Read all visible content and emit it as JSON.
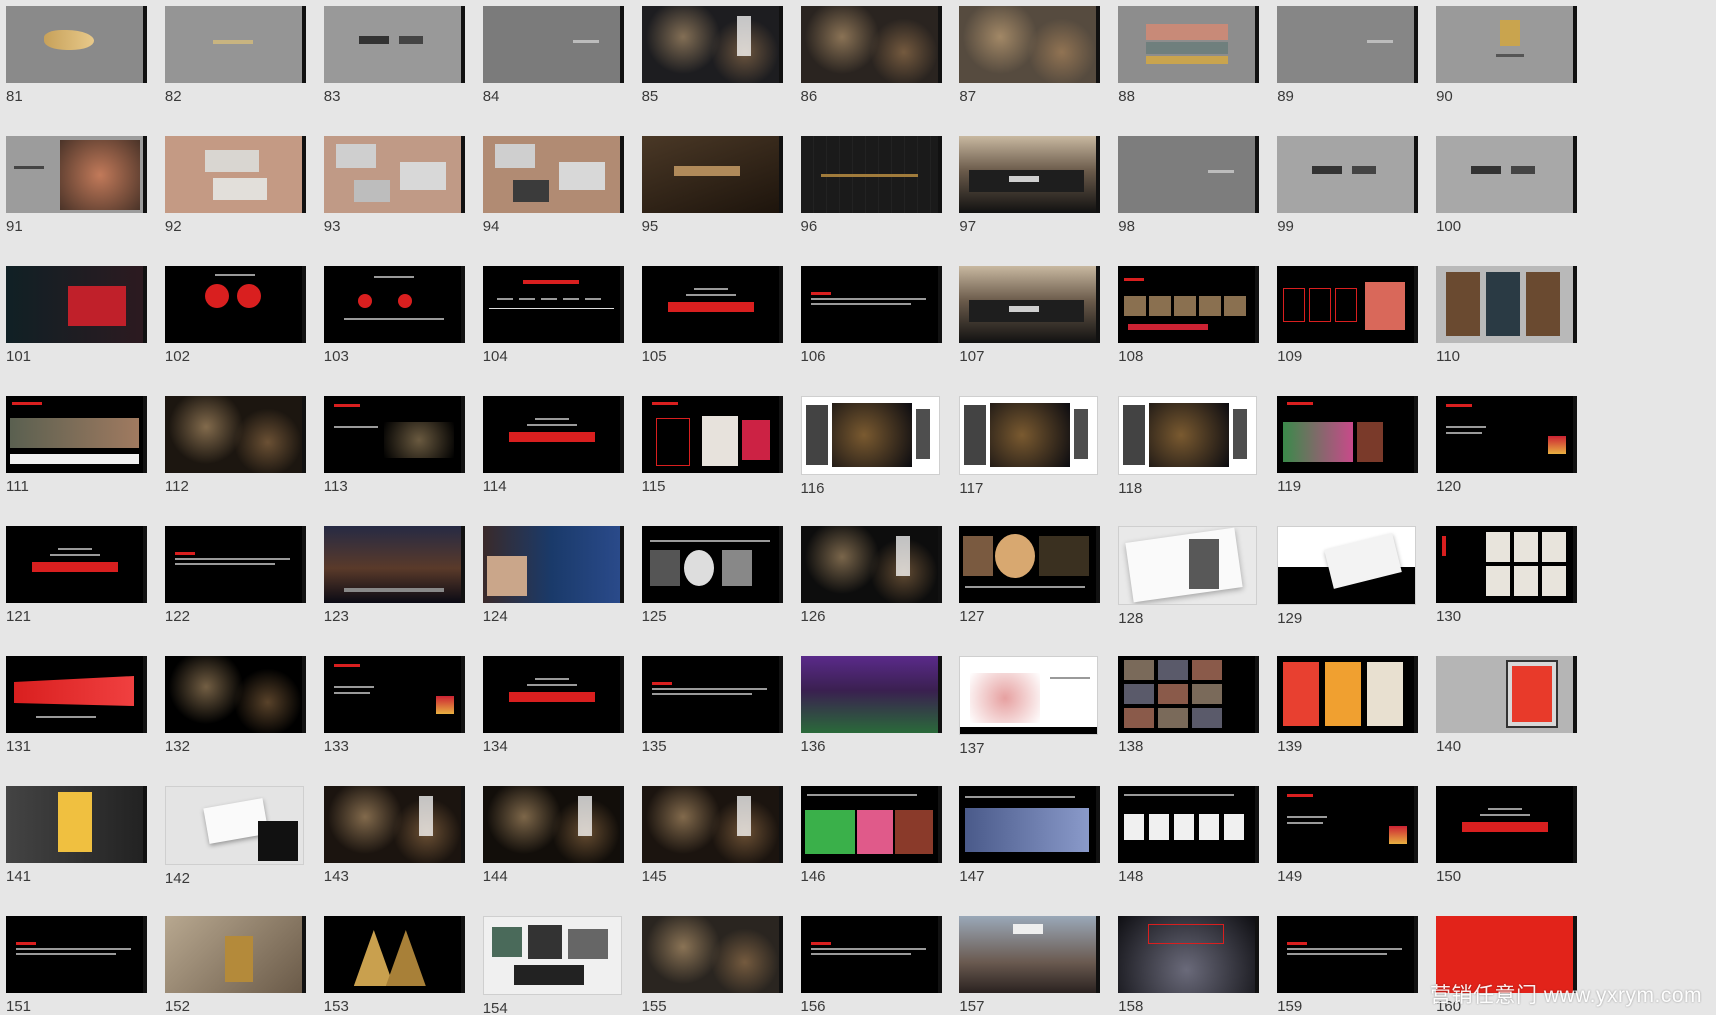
{
  "slides": [
    {
      "n": "81",
      "bg": "#8a8a8a",
      "style": "gold-mark"
    },
    {
      "n": "82",
      "bg": "#959595",
      "style": "small-text"
    },
    {
      "n": "83",
      "bg": "#999999",
      "style": "two-logos"
    },
    {
      "n": "84",
      "bg": "#7b7b7b",
      "style": "small-text-right"
    },
    {
      "n": "85",
      "bg": "#1d1d20",
      "style": "photo-crowd"
    },
    {
      "n": "86",
      "bg": "#2a2420",
      "style": "photo-bar"
    },
    {
      "n": "87",
      "bg": "#564b3f",
      "style": "photo-people"
    },
    {
      "n": "88",
      "bg": "#8d8d8d",
      "style": "color-blocks"
    },
    {
      "n": "89",
      "bg": "#868686",
      "style": "small-text-right"
    },
    {
      "n": "90",
      "bg": "#9a9a9a",
      "style": "gold-box"
    },
    {
      "n": "91",
      "bg": "#9c9c9c",
      "style": "photo-food"
    },
    {
      "n": "92",
      "bg": "#c49a84",
      "style": "cards"
    },
    {
      "n": "93",
      "bg": "#c09a86",
      "style": "stationery"
    },
    {
      "n": "94",
      "bg": "#b18b73",
      "style": "stationery-dark"
    },
    {
      "n": "95",
      "bg": "#2e2216",
      "style": "wood-logo"
    },
    {
      "n": "96",
      "bg": "#111111",
      "style": "dark-wall"
    },
    {
      "n": "97",
      "bg": "#3b3734",
      "style": "building"
    },
    {
      "n": "98",
      "bg": "#7d7d7d",
      "style": "small-text-right"
    },
    {
      "n": "99",
      "bg": "#a5a5a5",
      "style": "two-logos"
    },
    {
      "n": "100",
      "bg": "#a8a8a8",
      "style": "two-logos"
    },
    {
      "n": "101",
      "bg": "#1b2a2c",
      "style": "photo-night-red"
    },
    {
      "n": "102",
      "bg": "#000000",
      "style": "red-circles"
    },
    {
      "n": "103",
      "bg": "#000000",
      "style": "red-dots"
    },
    {
      "n": "104",
      "bg": "#000000",
      "style": "timeline"
    },
    {
      "n": "105",
      "bg": "#000000",
      "style": "red-title"
    },
    {
      "n": "106",
      "bg": "#000000",
      "style": "text-slide"
    },
    {
      "n": "107",
      "bg": "#1b1a18",
      "style": "photo-building"
    },
    {
      "n": "108",
      "bg": "#000000",
      "style": "photo-strip"
    },
    {
      "n": "109",
      "bg": "#000000",
      "style": "red-boxes"
    },
    {
      "n": "110",
      "bg": "#b9b9b9",
      "style": "posters"
    },
    {
      "n": "111",
      "bg": "#000000",
      "style": "photo-banner"
    },
    {
      "n": "112",
      "bg": "#1c1610",
      "style": "photo-night"
    },
    {
      "n": "113",
      "bg": "#000000",
      "style": "text-photo"
    },
    {
      "n": "114",
      "bg": "#000000",
      "style": "red-title"
    },
    {
      "n": "115",
      "bg": "#000000",
      "style": "collage-red"
    },
    {
      "n": "116",
      "bg": "#ffffff",
      "style": "white-calligraphy"
    },
    {
      "n": "117",
      "bg": "#ffffff",
      "style": "white-calligraphy"
    },
    {
      "n": "118",
      "bg": "#ffffff",
      "style": "white-calligraphy"
    },
    {
      "n": "119",
      "bg": "#000000",
      "style": "photo-green"
    },
    {
      "n": "120",
      "bg": "#000000",
      "style": "text-right-img"
    },
    {
      "n": "121",
      "bg": "#000000",
      "style": "red-title"
    },
    {
      "n": "122",
      "bg": "#000000",
      "style": "text-slide"
    },
    {
      "n": "123",
      "bg": "#1a1b2a",
      "style": "photo-river"
    },
    {
      "n": "124",
      "bg": "#0a1830",
      "style": "photo-stage"
    },
    {
      "n": "125",
      "bg": "#000000",
      "style": "collage-people"
    },
    {
      "n": "126",
      "bg": "#0d0d0d",
      "style": "photo-crowd"
    },
    {
      "n": "127",
      "bg": "#000000",
      "style": "collage-food"
    },
    {
      "n": "128",
      "bg": "#e9e9e9",
      "style": "white-book"
    },
    {
      "n": "129",
      "bg": "#ffffff",
      "style": "white-book-half"
    },
    {
      "n": "130",
      "bg": "#000000",
      "style": "maps"
    },
    {
      "n": "131",
      "bg": "#000000",
      "style": "toronto"
    },
    {
      "n": "132",
      "bg": "#000000",
      "style": "photo-interior"
    },
    {
      "n": "133",
      "bg": "#000000",
      "style": "text-right-img"
    },
    {
      "n": "134",
      "bg": "#000000",
      "style": "red-title"
    },
    {
      "n": "135",
      "bg": "#000000",
      "style": "text-slide"
    },
    {
      "n": "136",
      "bg": "#2c1a40",
      "style": "photo-purple"
    },
    {
      "n": "137",
      "bg": "#ffffff",
      "style": "white-map"
    },
    {
      "n": "138",
      "bg": "#000000",
      "style": "photo-grid"
    },
    {
      "n": "139",
      "bg": "#000000",
      "style": "posters-red"
    },
    {
      "n": "140",
      "bg": "#b5b5b5",
      "style": "billboard"
    },
    {
      "n": "141",
      "bg": "#2d2d2d",
      "style": "billboard-dark"
    },
    {
      "n": "142",
      "bg": "#e4e4e4",
      "style": "card-hand"
    },
    {
      "n": "143",
      "bg": "#1b140f",
      "style": "photo-interior-warm"
    },
    {
      "n": "144",
      "bg": "#120e0a",
      "style": "photo-interior-warm"
    },
    {
      "n": "145",
      "bg": "#1b140f",
      "style": "photo-interior-warm"
    },
    {
      "n": "146",
      "bg": "#000000",
      "style": "collage-color"
    },
    {
      "n": "147",
      "bg": "#000000",
      "style": "photo-event"
    },
    {
      "n": "148",
      "bg": "#000000",
      "style": "product-row"
    },
    {
      "n": "149",
      "bg": "#000000",
      "style": "text-right-img"
    },
    {
      "n": "150",
      "bg": "#000000",
      "style": "red-title"
    },
    {
      "n": "151",
      "bg": "#000000",
      "style": "text-slide"
    },
    {
      "n": "152",
      "bg": "#8f7f6b",
      "style": "product-gold"
    },
    {
      "n": "153",
      "bg": "#000000",
      "style": "gold-triangles"
    },
    {
      "n": "154",
      "bg": "#f0f0f0",
      "style": "packaging"
    },
    {
      "n": "155",
      "bg": "#2a2520",
      "style": "photo-people"
    },
    {
      "n": "156",
      "bg": "#000000",
      "style": "text-slide"
    },
    {
      "n": "157",
      "bg": "#6a625c",
      "style": "photo-street"
    },
    {
      "n": "158",
      "bg": "#0e0e12",
      "style": "photo-market"
    },
    {
      "n": "159",
      "bg": "#000000",
      "style": "text-center"
    },
    {
      "n": "160",
      "bg": "#e2231a",
      "style": "solid-red"
    }
  ],
  "watermark": "营销任意门 www.yxrym.com"
}
